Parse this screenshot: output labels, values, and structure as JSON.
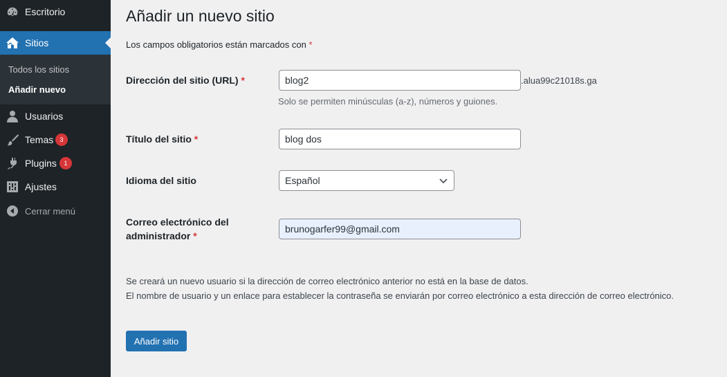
{
  "sidebar": {
    "items": [
      {
        "label": "Escritorio",
        "icon": "dashboard-icon"
      },
      {
        "label": "Sitios",
        "icon": "sites-icon"
      },
      {
        "label": "Usuarios",
        "icon": "users-icon"
      },
      {
        "label": "Temas",
        "icon": "themes-icon",
        "badge": "3"
      },
      {
        "label": "Plugins",
        "icon": "plugins-icon",
        "badge": "1"
      },
      {
        "label": "Ajustes",
        "icon": "settings-icon"
      },
      {
        "label": "Cerrar menú",
        "icon": "collapse-icon"
      }
    ],
    "submenu": [
      {
        "label": "Todos los sitios"
      },
      {
        "label": "Añadir nuevo"
      }
    ]
  },
  "page": {
    "title": "Añadir un nuevo sitio",
    "required_note": "Los campos obligatorios están marcados con",
    "required_mark": "*"
  },
  "form": {
    "url_label": "Dirección del sitio (URL)",
    "url_value": "blog2",
    "url_suffix": ".alua99c21018s.ga",
    "url_help": "Solo se permiten minúsculas (a-z), números y guiones.",
    "title_label": "Título del sitio",
    "title_value": "blog dos",
    "language_label": "Idioma del sitio",
    "language_value": "Español",
    "email_label_line1": "Correo electrónico del",
    "email_label_line2": "administrador",
    "email_value": "brunogarfer99@gmail.com",
    "info_line1": "Se creará un nuevo usuario si la dirección de correo electrónico anterior no está en la base de datos.",
    "info_line2": "El nombre de usuario y un enlace para establecer la contraseña se enviarán por correo electrónico a esta dirección de correo electrónico.",
    "submit_label": "Añadir sitio"
  },
  "colors": {
    "sidebar_bg": "#1d2327",
    "submenu_bg": "#2c3338",
    "accent": "#2271b1",
    "badge": "#d63638",
    "required": "#d63638"
  }
}
